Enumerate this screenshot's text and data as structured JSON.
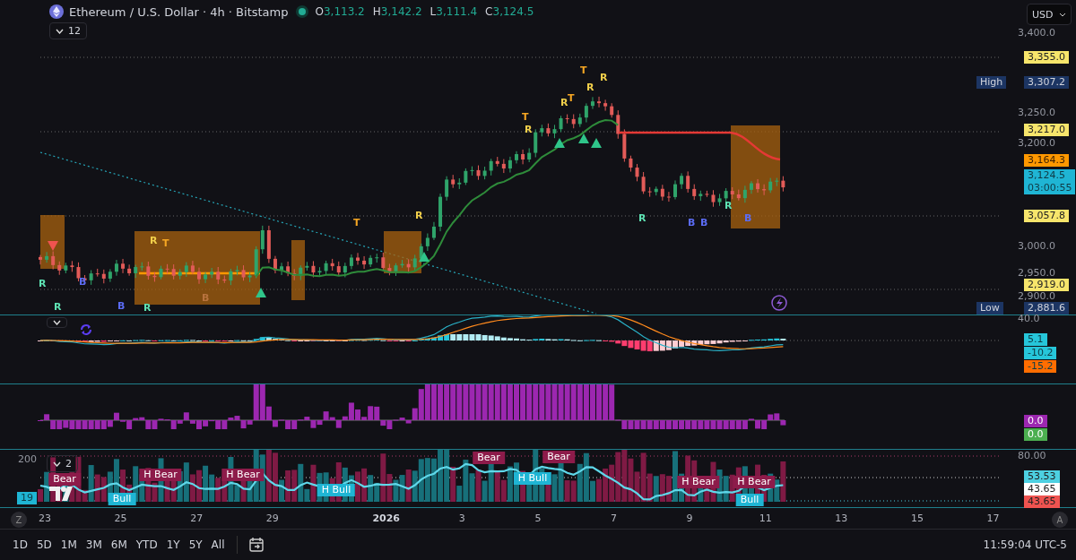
{
  "header": {
    "symbol_title": "Ethereum / U.S. Dollar · 4h · Bitstamp",
    "market_open": true,
    "ohlc": [
      {
        "label": "O",
        "value": "3,113.2"
      },
      {
        "label": "H",
        "value": "3,142.2"
      },
      {
        "label": "L",
        "value": "3,111.4"
      },
      {
        "label": "C",
        "value": "3,124.5"
      }
    ],
    "indicators_toggle": {
      "count": "12",
      "expanded": false
    }
  },
  "currency_select": "USD",
  "price_axis": {
    "ticks": [
      "3,400.0",
      "3,250.0",
      "3,200.0",
      "3,000.0",
      "2,950.0",
      "2,900.0"
    ]
  },
  "price_labels": [
    {
      "kind": "level",
      "text": "3,355.0"
    },
    {
      "kind": "high",
      "label": "High",
      "text": "3,307.2"
    },
    {
      "kind": "level",
      "text": "3,217.0"
    },
    {
      "kind": "stop",
      "text": "3,164.3"
    },
    {
      "kind": "last",
      "text": "3,124.5",
      "countdown": "03:00:55"
    },
    {
      "kind": "level",
      "text": "3,057.8"
    },
    {
      "kind": "level",
      "text": "2,919.0"
    },
    {
      "kind": "low",
      "label": "Low",
      "text": "2,881.6"
    }
  ],
  "signals": [
    {
      "text": "R",
      "color": "#5fe3b4"
    },
    {
      "text": "R",
      "color": "#5fe3b4"
    },
    {
      "text": "B",
      "color": "#5b6cf5"
    },
    {
      "text": "B",
      "color": "#5b6cf5"
    },
    {
      "text": "R",
      "color": "#5fe3b4"
    },
    {
      "text": "R",
      "color": "#f2d04b"
    },
    {
      "text": "T",
      "color": "#f5a623"
    },
    {
      "text": "B",
      "color": "#b8733e"
    },
    {
      "text": "T",
      "color": "#f5a623"
    },
    {
      "text": "R",
      "color": "#f2d04b"
    },
    {
      "text": "T",
      "color": "#f5a623"
    },
    {
      "text": "R",
      "color": "#f2d04b"
    },
    {
      "text": "R",
      "color": "#f2d04b"
    },
    {
      "text": "T",
      "color": "#f5a623"
    },
    {
      "text": "T",
      "color": "#f5a623"
    },
    {
      "text": "R",
      "color": "#f2d04b"
    },
    {
      "text": "R",
      "color": "#f2d04b"
    },
    {
      "text": "R",
      "color": "#5fe3b4"
    },
    {
      "text": "B",
      "color": "#5b6cf5"
    },
    {
      "text": "B",
      "color": "#5b6cf5"
    },
    {
      "text": "R",
      "color": "#5fe3b4"
    },
    {
      "text": "B",
      "color": "#5b6cf5"
    }
  ],
  "macd_pane": {
    "toggle_expanded": false,
    "axis_tick": "40.0",
    "values": [
      {
        "text": "5.1",
        "color": "#26c6da"
      },
      {
        "text": "-10.2",
        "color": "#26c6da"
      },
      {
        "text": "-15.2",
        "color": "#ff6d00"
      }
    ]
  },
  "oscillator_pane": {
    "values": [
      {
        "text": "0.0",
        "color": "#9c27b0"
      },
      {
        "text": "0.0",
        "color": "#4caf50"
      }
    ]
  },
  "rsi_pane": {
    "toggle": {
      "count": "2",
      "expanded": false
    },
    "left_tick": "200",
    "axis_tick": "80.00",
    "left_label": "19",
    "divergences": [
      {
        "kind": "bear",
        "text": "Bear"
      },
      {
        "kind": "bull",
        "text": "Bull"
      },
      {
        "kind": "bear",
        "text": "H Bear"
      },
      {
        "kind": "bear",
        "text": "H Bear"
      },
      {
        "kind": "bull",
        "text": "H Bull"
      },
      {
        "kind": "bear",
        "text": "Bear"
      },
      {
        "kind": "bull",
        "text": "H Bull"
      },
      {
        "kind": "bear",
        "text": "Bear"
      },
      {
        "kind": "bear",
        "text": "H Bear"
      },
      {
        "kind": "bear",
        "text": "H Bear"
      },
      {
        "kind": "bull",
        "text": "Bull"
      }
    ],
    "values": [
      {
        "text": "53.53",
        "color": "#4dd0e1"
      },
      {
        "text": "43.65",
        "color": "#ffffff"
      },
      {
        "text": "43.65",
        "color": "#ef5350"
      }
    ]
  },
  "time_axis": {
    "ticks": [
      "23",
      "25",
      "27",
      "29",
      "2026",
      "3",
      "5",
      "7",
      "9",
      "11",
      "13",
      "15",
      "17"
    ]
  },
  "scale_buttons": {
    "left": "Z",
    "right": "A"
  },
  "range_buttons": [
    "1D",
    "5D",
    "1M",
    "3M",
    "6M",
    "YTD",
    "1Y",
    "5Y",
    "All"
  ],
  "clock": "11:59:04 UTC-5"
}
